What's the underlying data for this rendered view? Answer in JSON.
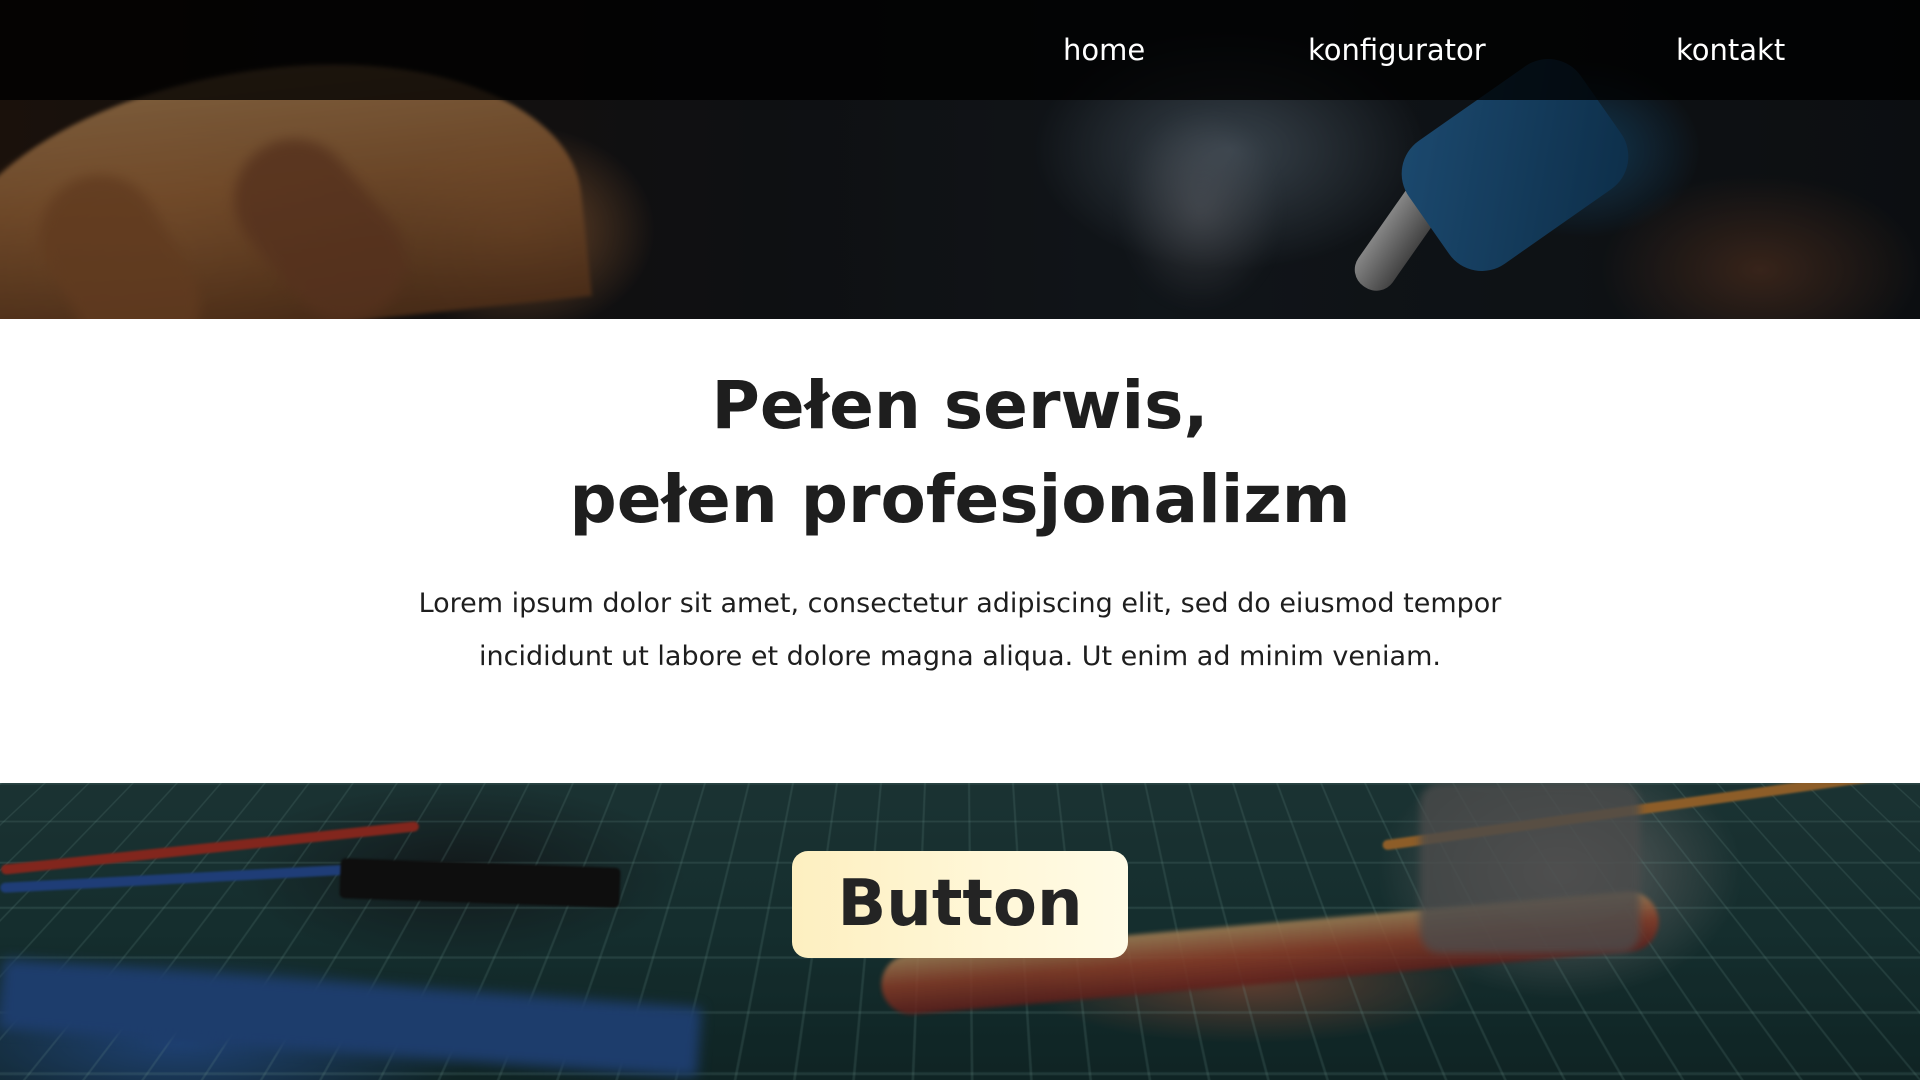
{
  "nav": {
    "items": [
      {
        "label": "home"
      },
      {
        "label": "konfigurator"
      },
      {
        "label": "kontakt"
      }
    ]
  },
  "hero": {
    "headline_line1": "Pełen serwis,",
    "headline_line2": "pełen profesjonalizm",
    "lead": "Lorem ipsum dolor sit amet, consectetur adipiscing elit, sed do eiusmod tempor incididunt ut labore et dolore magna aliqua. Ut enim ad minim veniam."
  },
  "cta": {
    "label": "Button"
  },
  "colors": {
    "nav_background": "#000000",
    "nav_text": "#ffffff",
    "content_background": "#ffffff",
    "text_dark": "#1e1e1e",
    "button_background": "#fff6d6",
    "button_text": "#242424"
  },
  "images": {
    "top_banner": "soldering-photo",
    "bottom_banner": "electronics-workbench-photo"
  }
}
